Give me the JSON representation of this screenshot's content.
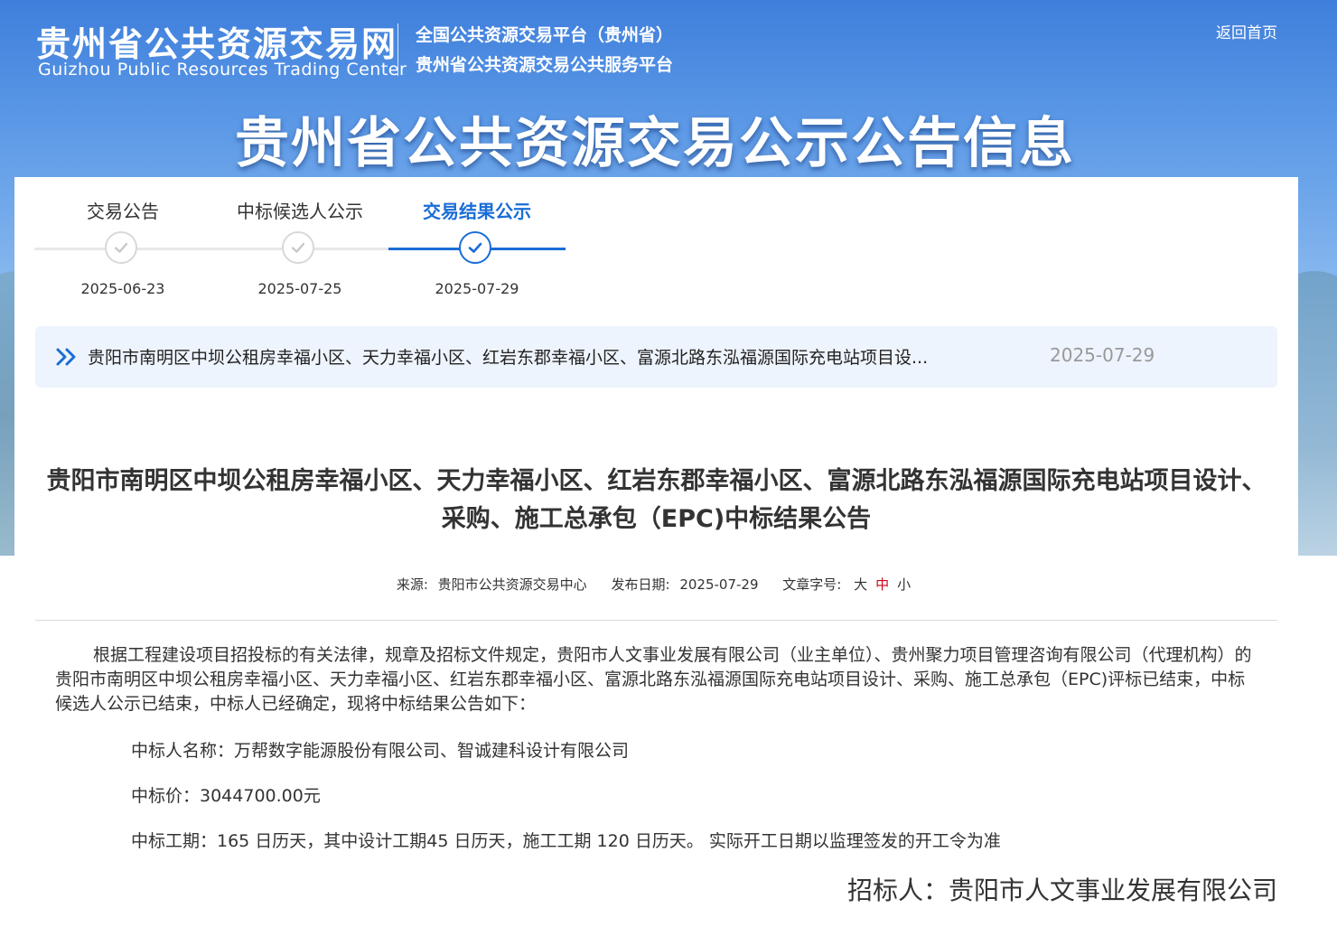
{
  "header": {
    "logo_cn": "贵州省公共资源交易网",
    "logo_en": "Guizhou Public Resources Trading Center",
    "platform_line1": "全国公共资源交易平台（贵州省）",
    "platform_line2": "贵州省公共资源交易公共服务平台",
    "home_link": "返回首页",
    "banner_title": "贵州省公共资源交易公示公告信息"
  },
  "steps": [
    {
      "label": "交易公告",
      "date": "2025-06-23",
      "active": false
    },
    {
      "label": "中标候选人公示",
      "date": "2025-07-25",
      "active": false
    },
    {
      "label": "交易结果公示",
      "date": "2025-07-29",
      "active": true
    }
  ],
  "notice": {
    "icon": "double-chevron-right-icon",
    "title": "贵阳市南明区中坝公租房幸福小区、天力幸福小区、红岩东郡幸福小区、富源北路东泓福源国际充电站项目设...",
    "date": "2025-07-29"
  },
  "article": {
    "title_line1": "贵阳市南明区中坝公租房幸福小区、天力幸福小区、红岩东郡幸福小区、富源北路东泓福源国际充电站项目设计、",
    "title_line2": "采购、施工总承包（EPC)中标结果公告",
    "meta": {
      "source_label": "来源:",
      "source_value": "贵阳市公共资源交易中心",
      "date_label": "发布日期:",
      "date_value": "2025-07-29",
      "fontsize_label": "文章字号:",
      "font_large": "大",
      "font_medium": "中",
      "font_small": "小"
    },
    "paragraph": "根据工程建设项目招投标的有关法律，规章及招标文件规定，贵阳市人文事业发展有限公司（业主单位）、贵州聚力项目管理咨询有限公司（代理机构）的贵阳市南明区中坝公租房幸福小区、天力幸福小区、红岩东郡幸福小区、富源北路东泓福源国际充电站项目设计、采购、施工总承包（EPC)评标已结束，中标候选人公示已结束，中标人已经确定，现将中标结果公告如下：",
    "winner": "中标人名称：万帮数字能源股份有限公司、智诚建科设计有限公司",
    "price": "中标价：3044700.00元",
    "period": "中标工期：165 日历天，其中设计工期45 日历天，施工工期 120 日历天。 实际开工日期以监理签发的开工令为准",
    "signer": "招标人：贵阳市人文事业发展有限公司"
  },
  "colors": {
    "accent": "#1a6dd6",
    "current_font": "#d0021b",
    "notice_bg": "#eef4fd"
  }
}
